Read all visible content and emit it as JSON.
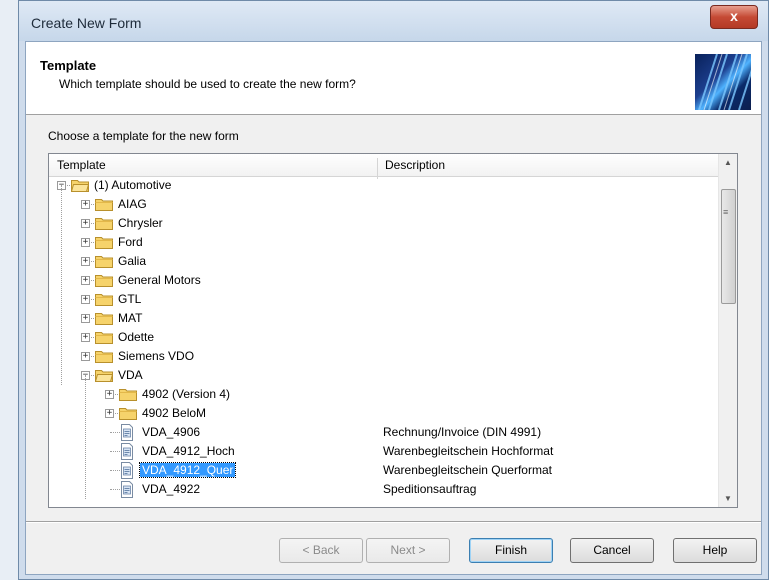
{
  "window": {
    "title": "Create New Form",
    "close_glyph": "x"
  },
  "header": {
    "title": "Template",
    "subtitle": "Which template should be used to create the new form?",
    "logo_icon": "wizard-graphic-icon"
  },
  "choose_label": "Choose a template for the new form",
  "columns": {
    "template": "Template",
    "description": "Description"
  },
  "tree": [
    {
      "label": "(1) Automotive",
      "type": "folder",
      "level": 0,
      "expanded": true,
      "description": ""
    },
    {
      "label": "AIAG",
      "type": "folder",
      "level": 1,
      "expanded": false,
      "description": ""
    },
    {
      "label": "Chrysler",
      "type": "folder",
      "level": 1,
      "expanded": false,
      "description": ""
    },
    {
      "label": "Ford",
      "type": "folder",
      "level": 1,
      "expanded": false,
      "description": ""
    },
    {
      "label": "Galia",
      "type": "folder",
      "level": 1,
      "expanded": false,
      "description": ""
    },
    {
      "label": "General Motors",
      "type": "folder",
      "level": 1,
      "expanded": false,
      "description": ""
    },
    {
      "label": "GTL",
      "type": "folder",
      "level": 1,
      "expanded": false,
      "description": ""
    },
    {
      "label": "MAT",
      "type": "folder",
      "level": 1,
      "expanded": false,
      "description": ""
    },
    {
      "label": "Odette",
      "type": "folder",
      "level": 1,
      "expanded": false,
      "description": ""
    },
    {
      "label": "Siemens VDO",
      "type": "folder",
      "level": 1,
      "expanded": false,
      "description": ""
    },
    {
      "label": "VDA",
      "type": "folder",
      "level": 1,
      "expanded": true,
      "description": ""
    },
    {
      "label": "4902 (Version 4)",
      "type": "folder",
      "level": 2,
      "expanded": false,
      "description": ""
    },
    {
      "label": "4902 BeloM",
      "type": "folder",
      "level": 2,
      "expanded": false,
      "description": ""
    },
    {
      "label": "VDA_4906",
      "type": "file",
      "level": 2,
      "description": "Rechnung/Invoice (DIN 4991)"
    },
    {
      "label": "VDA_4912_Hoch",
      "type": "file",
      "level": 2,
      "description": "Warenbegleitschein Hochformat"
    },
    {
      "label": "VDA_4912_Quer",
      "type": "file",
      "level": 2,
      "selected": true,
      "description": "Warenbegleitschein Querformat"
    },
    {
      "label": "VDA_4922",
      "type": "file",
      "level": 2,
      "description": "Speditionsauftrag"
    }
  ],
  "buttons": {
    "back": "< Back",
    "next": "Next >",
    "finish": "Finish",
    "cancel": "Cancel",
    "help": "Help"
  },
  "colors": {
    "selection": "#3399ff",
    "folder": "#f6d36b",
    "close": "#c54a35"
  }
}
